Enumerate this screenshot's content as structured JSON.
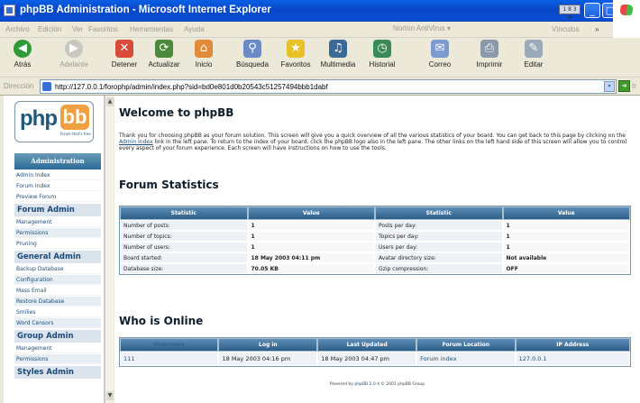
{
  "window": {
    "title": "phpBB Administration - Microsoft Internet Explorer",
    "tray_text": "1 8 3 #",
    "minimize": "_",
    "maximize": "□",
    "close": "✕"
  },
  "menu": {
    "items": [
      "Archivo",
      "Edición",
      "Ver",
      "Favoritos",
      "Herramientas",
      "Ayuda"
    ],
    "norton": "Norton AntiVirus",
    "vinculos": "Vínculos"
  },
  "toolbar": {
    "back": "Atrás",
    "forward": "Adelante",
    "stop": "Detener",
    "refresh": "Actualizar",
    "home": "Inicio",
    "search": "Búsqueda",
    "favorites": "Favoritos",
    "media": "Multimedia",
    "history": "Historial",
    "mail": "Correo",
    "print": "Imprimir",
    "edit": "Editar"
  },
  "address": {
    "label": "Dirección",
    "url": "http://127.0.0.1/forophp/admin/index.php?sid=bd0e801d0b20543c51257494bbb1dabf",
    "go": "Ir"
  },
  "sidebar": {
    "logo_text": "php",
    "logo_bb": "bb",
    "logo_tag": "forum that's free",
    "admin_header": "Administration",
    "items_top": [
      "Admin Index",
      "Forum Index",
      "Preview Forum"
    ],
    "forum_admin": "Forum Admin",
    "forum_items": [
      "Management",
      "Permissions",
      "Pruning"
    ],
    "general_admin": "General Admin",
    "general_items": [
      "Backup Database",
      "Configuration",
      "Mass Email",
      "Restore Database",
      "Smilies",
      "Word Censors"
    ],
    "group_admin": "Group Admin",
    "group_items": [
      "Management",
      "Permissions"
    ],
    "styles_admin": "Styles Admin"
  },
  "content": {
    "welcome_title": "Welcome to phpBB",
    "intro_before": "Thank you for choosing phpBB as your forum solution. This screen will give you a quick overview of all the various statistics of your board. You can get back to this page by clicking on the ",
    "intro_link": "Admin Index",
    "intro_after": " link in the left pane. To return to the index of your board, click the phpBB logo also in the left pane. The other links on the left hand side of this screen will allow you to control every aspect of your forum experience. Each screen will have instructions on how to use the tools.",
    "stats_title": "Forum Statistics",
    "stats_headers": [
      "Statistic",
      "Value",
      "Statistic",
      "Value"
    ],
    "stats_rows": [
      [
        "Number of posts:",
        "1",
        "Posts per day:",
        "1"
      ],
      [
        "Number of topics:",
        "1",
        "Topics per day:",
        "1"
      ],
      [
        "Number of users:",
        "1",
        "Users per day:",
        "1"
      ],
      [
        "Board started:",
        "18 May 2003 04:11 pm",
        "Avatar directory size:",
        "Not available"
      ],
      [
        "Database size:",
        "70.05 KB",
        "Gzip compression:",
        "OFF"
      ]
    ],
    "online_title": "Who is Online",
    "online_headers": [
      "Username",
      "Log in",
      "Last Updated",
      "Forum Location",
      "IP Address"
    ],
    "online_row": [
      "111",
      "18 May 2003 04:16 pm",
      "18 May 2003 04:47 pm",
      "Forum index",
      "127.0.0.1"
    ],
    "footer_before": "Powered by ",
    "footer_link": "phpBB 2.0.4",
    "footer_after": " © 2001 phpBB Group"
  }
}
